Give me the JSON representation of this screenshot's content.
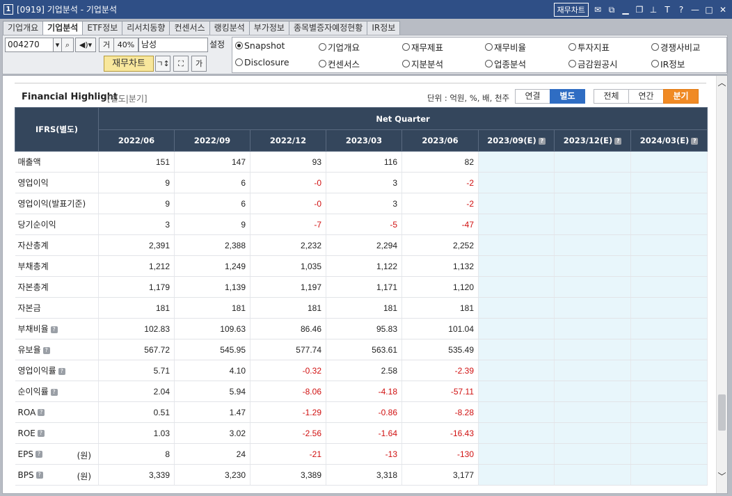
{
  "window": {
    "number": "1",
    "title": "[0919] 기업분석 - 기업분석",
    "chart_button": "재무차트"
  },
  "tabs": [
    "기업개요",
    "기업분석",
    "ETF정보",
    "리서치동향",
    "컨센서스",
    "랭킹분석",
    "부가정보",
    "종목별증자예정현황",
    "IR정보"
  ],
  "toolbar": {
    "code": "004270",
    "ratio": "40%",
    "ratio_prefix": "거",
    "company": "남성",
    "setting": "설정",
    "chart_button": "재무차트"
  },
  "radios": [
    {
      "label": "Snapshot",
      "selected": true
    },
    {
      "label": "기업개요",
      "selected": false
    },
    {
      "label": "재무제표",
      "selected": false
    },
    {
      "label": "재무비율",
      "selected": false
    },
    {
      "label": "투자지표",
      "selected": false
    },
    {
      "label": "경쟁사비교",
      "selected": false
    },
    {
      "label": "Disclosure",
      "selected": false
    },
    {
      "label": "컨센서스",
      "selected": false
    },
    {
      "label": "지분분석",
      "selected": false
    },
    {
      "label": "업종분석",
      "selected": false
    },
    {
      "label": "금감원공시",
      "selected": false
    },
    {
      "label": "IR정보",
      "selected": false
    }
  ],
  "highlight": {
    "title": "Financial Highlight",
    "subtitle": "[별도|분기]",
    "unit": "단위 : 억원, %, 배, 천주",
    "scope_buttons": [
      "연결",
      "별도"
    ],
    "period_buttons": [
      "전체",
      "연간",
      "분기"
    ],
    "header_left": "IFRS(별도)",
    "header_group": "Net Quarter",
    "periods": [
      "2022/06",
      "2022/09",
      "2022/12",
      "2023/03",
      "2023/06",
      "2023/09(E)",
      "2023/12(E)",
      "2024/03(E)"
    ],
    "rows": [
      {
        "label": "매출액",
        "values": [
          "151",
          "147",
          "93",
          "116",
          "82"
        ]
      },
      {
        "label": "영업이익",
        "values": [
          "9",
          "6",
          "-0",
          "3",
          "-2"
        ]
      },
      {
        "label": "영업이익(발표기준)",
        "values": [
          "9",
          "6",
          "-0",
          "3",
          "-2"
        ]
      },
      {
        "label": "당기순이익",
        "values": [
          "3",
          "9",
          "-7",
          "-5",
          "-47"
        ]
      },
      {
        "label": "자산총계",
        "values": [
          "2,391",
          "2,388",
          "2,232",
          "2,294",
          "2,252"
        ]
      },
      {
        "label": "부채총계",
        "values": [
          "1,212",
          "1,249",
          "1,035",
          "1,122",
          "1,132"
        ]
      },
      {
        "label": "자본총계",
        "values": [
          "1,179",
          "1,139",
          "1,197",
          "1,171",
          "1,120"
        ]
      },
      {
        "label": "자본금",
        "values": [
          "181",
          "181",
          "181",
          "181",
          "181"
        ]
      },
      {
        "label": "부채비율",
        "help": true,
        "values": [
          "102.83",
          "109.63",
          "86.46",
          "95.83",
          "101.04"
        ]
      },
      {
        "label": "유보율",
        "help": true,
        "values": [
          "567.72",
          "545.95",
          "577.74",
          "563.61",
          "535.49"
        ]
      },
      {
        "label": "영업이익률",
        "help": true,
        "values": [
          "5.71",
          "4.10",
          "-0.32",
          "2.58",
          "-2.39"
        ]
      },
      {
        "label": "순이익률",
        "help": true,
        "values": [
          "2.04",
          "5.94",
          "-8.06",
          "-4.18",
          "-57.11"
        ]
      },
      {
        "label": "ROA",
        "help": true,
        "values": [
          "0.51",
          "1.47",
          "-1.29",
          "-0.86",
          "-8.28"
        ]
      },
      {
        "label": "ROE",
        "help": true,
        "values": [
          "1.03",
          "3.02",
          "-2.56",
          "-1.64",
          "-16.43"
        ]
      },
      {
        "label": "EPS",
        "help": true,
        "unit": "(원)",
        "values": [
          "8",
          "24",
          "-21",
          "-13",
          "-130"
        ]
      },
      {
        "label": "BPS",
        "help": true,
        "unit": "(원)",
        "values": [
          "3,339",
          "3,230",
          "3,389",
          "3,318",
          "3,177"
        ]
      }
    ]
  },
  "colors": {
    "negative": "#d01010",
    "header": "#34465c",
    "estimate_bg": "#e8f6fb",
    "accent": "#f08a24"
  }
}
